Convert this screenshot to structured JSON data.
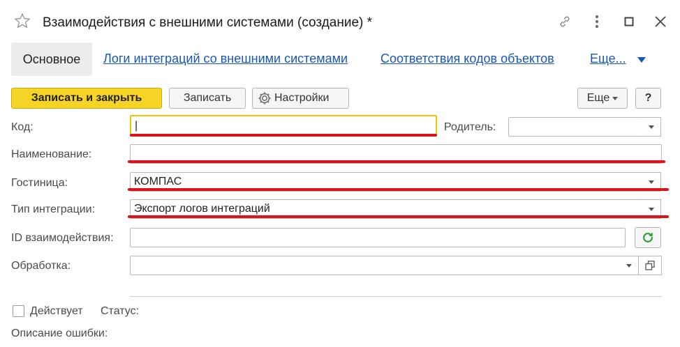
{
  "window": {
    "title": "Взаимодействия с внешними системами (создание) *",
    "icons": [
      "star-icon",
      "link-icon",
      "more-vertical-icon",
      "maximize-icon",
      "close-icon"
    ]
  },
  "tabs": {
    "main": "Основное",
    "logs": "Логи интеграций со внешними системами",
    "codes": "Соответствия кодов объектов",
    "more": "Еще..."
  },
  "toolbar": {
    "save_close": "Записать и закрыть",
    "save": "Записать",
    "settings": "Настройки",
    "more": "Еще",
    "help": "?"
  },
  "form": {
    "code_label": "Код:",
    "code_value": "|",
    "parent_label": "Родитель:",
    "parent_value": "",
    "name_label": "Наименование:",
    "name_value": "",
    "hotel_label": "Гостиница:",
    "hotel_value": "КОМПАС",
    "integration_type_label": "Тип интеграции:",
    "integration_type_value": "Экспорт логов интеграций",
    "interaction_id_label": "ID взаимодействия:",
    "interaction_id_value": "",
    "processing_label": "Обработка:",
    "processing_value": "",
    "active_label": "Действует",
    "status_label": "Статус:",
    "error_label": "Описание ошибки:"
  },
  "colors": {
    "primary_button": "#f5d425",
    "link": "#1a57b5",
    "annotation_line": "#d8141c",
    "focus_border": "#f0c400",
    "refresh_icon": "#2a9d3a"
  }
}
